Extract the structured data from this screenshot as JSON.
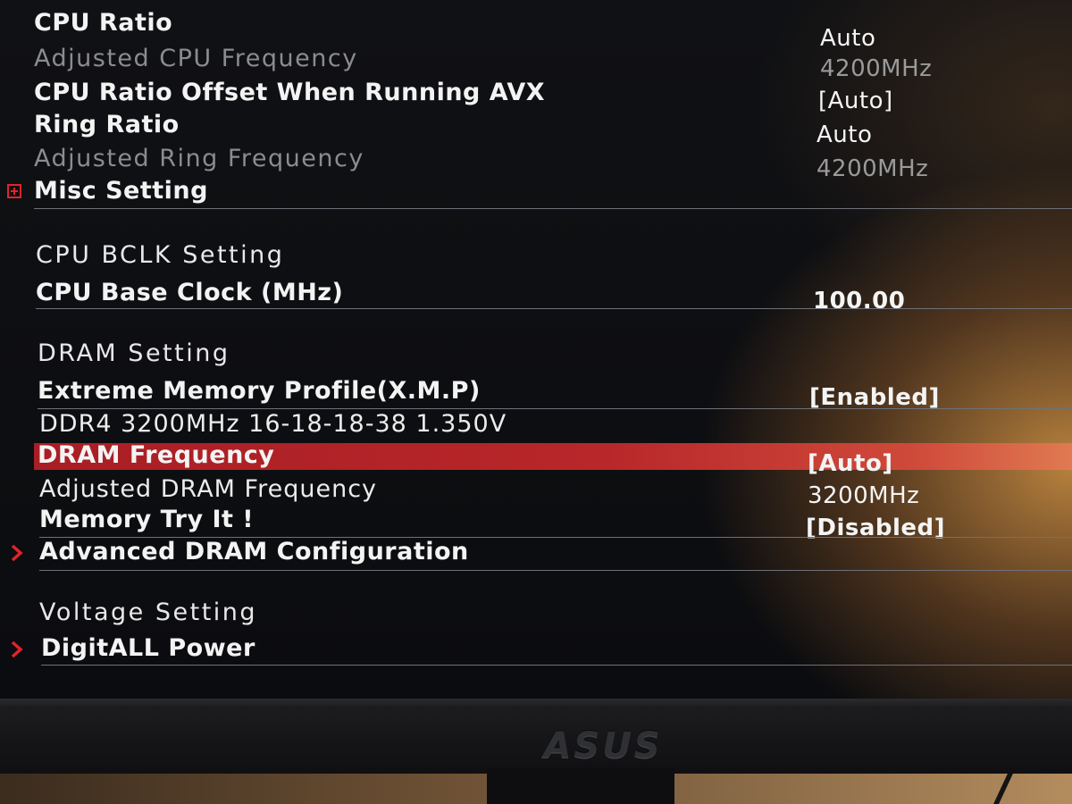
{
  "settings_top": [
    {
      "label": "CPU Ratio",
      "value": "Auto",
      "style": "normal"
    },
    {
      "label": "Adjusted CPU Frequency",
      "value": "4200MHz",
      "style": "dim"
    },
    {
      "label": "CPU Ratio Offset When Running AVX",
      "value": "[Auto]",
      "style": "normal"
    },
    {
      "label": "Ring Ratio",
      "value": "Auto",
      "style": "normal"
    },
    {
      "label": "Adjusted Ring Frequency",
      "value": "4200MHz",
      "style": "dim"
    },
    {
      "label": "Misc Setting",
      "value": "",
      "style": "expand"
    }
  ],
  "bclk": {
    "section_title": "CPU  BCLK  Setting",
    "base_clock_label": "CPU Base Clock (MHz)",
    "base_clock_value": "100.00"
  },
  "dram": {
    "section_title": "DRAM  Setting",
    "xmp_label": "Extreme Memory Profile(X.M.P)",
    "xmp_value": "[Enabled]",
    "xmp_info": "DDR4 3200MHz 16-18-18-38 1.350V",
    "freq_label": "DRAM Frequency",
    "freq_value": "[Auto]",
    "adjusted_label": "Adjusted DRAM Frequency",
    "adjusted_value": "3200MHz",
    "try_label": "Memory Try It !",
    "try_value": "[Disabled]",
    "advanced_label": "Advanced DRAM Configuration"
  },
  "voltage": {
    "section_title": "Voltage  Setting",
    "digitall_label": "DigitALL Power"
  },
  "monitor": {
    "brand": "ASUS"
  },
  "colors": {
    "highlight": "#b8272a",
    "icon_red": "#e0242a",
    "text": "#f3f3f3",
    "dim_text": "#8a8c90"
  }
}
